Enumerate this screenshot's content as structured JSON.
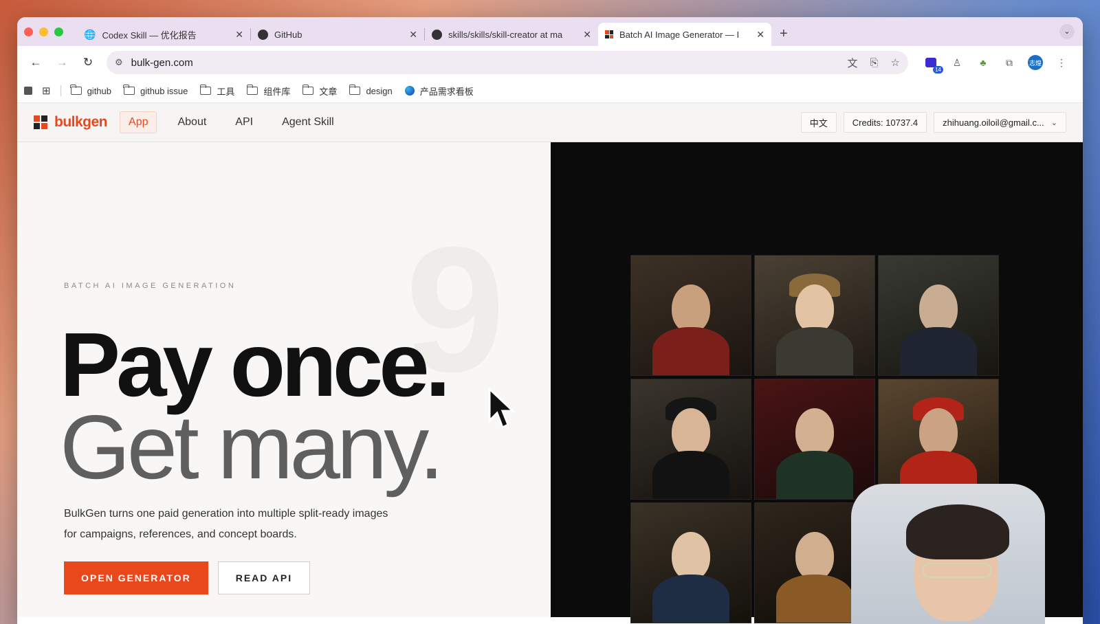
{
  "browser": {
    "tabs": [
      {
        "title": "Codex Skill — 优化报告",
        "icon": "globe-icon",
        "active": false
      },
      {
        "title": "GitHub",
        "icon": "github-icon",
        "active": false
      },
      {
        "title": "skills/skills/skill-creator at ma",
        "icon": "github-icon",
        "active": false
      },
      {
        "title": "Batch AI Image Generator — I",
        "icon": "bulkgen-icon",
        "active": true
      }
    ],
    "url": "bulk-gen.com",
    "extension_badge": "14",
    "profile_initials": "志煌",
    "bookmarks": [
      {
        "label": "github",
        "icon": "folder-icon"
      },
      {
        "label": "github issue",
        "icon": "folder-icon"
      },
      {
        "label": "工具",
        "icon": "folder-icon"
      },
      {
        "label": "组件库",
        "icon": "folder-icon"
      },
      {
        "label": "文章",
        "icon": "folder-icon"
      },
      {
        "label": "design",
        "icon": "folder-icon"
      },
      {
        "label": "产品需求看板",
        "icon": "app-icon"
      }
    ]
  },
  "site": {
    "logo_text": "bulkgen",
    "nav": [
      {
        "label": "App",
        "active": true
      },
      {
        "label": "About",
        "active": false
      },
      {
        "label": "API",
        "active": false
      },
      {
        "label": "Agent Skill",
        "active": false
      }
    ],
    "lang_button": "中文",
    "credits": "Credits: 10737.4",
    "account": "zhihuang.oiloil@gmail.c..."
  },
  "hero": {
    "ghost_digit": "9",
    "eyebrow": "BATCH AI IMAGE GENERATION",
    "headline_1": "Pay once.",
    "headline_2": "Get many.",
    "description_1": "BulkGen turns one paid generation into multiple split-ready images",
    "description_2": "for campaigns, references, and concept boards.",
    "cta_primary": "OPEN GENERATOR",
    "cta_secondary": "READ API"
  },
  "gallery": {
    "tiles": [
      {
        "name": "portrait-bearded-man"
      },
      {
        "name": "portrait-woman-headdress"
      },
      {
        "name": "portrait-scholar-reading"
      },
      {
        "name": "portrait-young-man-cap"
      },
      {
        "name": "portrait-woman-red-hair"
      },
      {
        "name": "portrait-cardinal"
      },
      {
        "name": "portrait-woman-praying"
      },
      {
        "name": "portrait-lute-player"
      }
    ]
  },
  "colors": {
    "brand": "#e8481c",
    "tab_strip": "#eadff0",
    "gallery_bg": "#0b0b0b"
  }
}
